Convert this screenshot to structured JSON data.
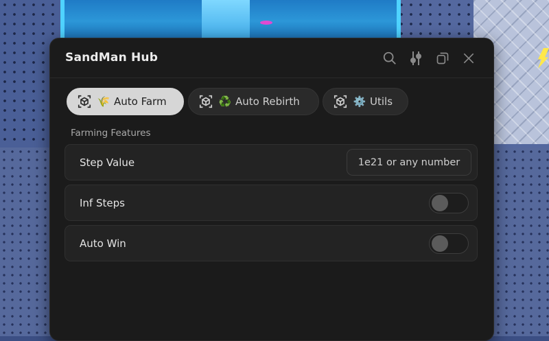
{
  "window": {
    "title": "SandMan Hub"
  },
  "tabs": [
    {
      "label": "Auto Farm",
      "emoji": "🌾",
      "active": true
    },
    {
      "label": "Auto Rebirth",
      "emoji": "♻️",
      "active": false
    },
    {
      "label": "Utils",
      "emoji": "⚙️",
      "active": false
    }
  ],
  "section": {
    "title": "Farming Features"
  },
  "rows": {
    "step_value": {
      "label": "Step Value",
      "placeholder": "1e21 or any number"
    },
    "inf_steps": {
      "label": "Inf Steps",
      "enabled": false
    },
    "auto_win": {
      "label": "Auto Win",
      "enabled": false
    }
  },
  "icons": {
    "search": "search-icon",
    "settings": "sliders-icon",
    "minimize": "minimize-icon",
    "close": "close-icon",
    "tab": "cube-icon"
  },
  "colors": {
    "window_bg": "#1b1b1b",
    "row_bg": "#232323",
    "active_tab": "#d6d6d6",
    "toggle_off_knob": "#5b5b5b"
  }
}
